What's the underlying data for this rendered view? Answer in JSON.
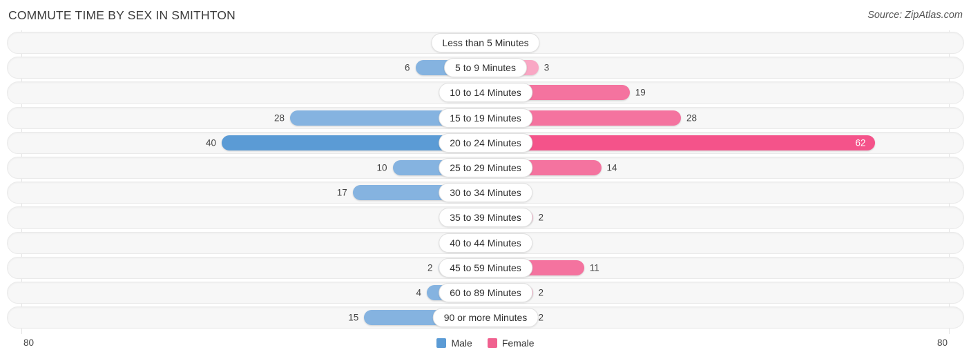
{
  "header": {
    "title": "COMMUTE TIME BY SEX IN SMITHTON",
    "source": "Source: ZipAtlas.com"
  },
  "axis": {
    "left_label": "80",
    "right_label": "80"
  },
  "legend": {
    "items": [
      {
        "label": "Male",
        "color": "#5b9bd5"
      },
      {
        "label": "Female",
        "color": "#f0618f"
      }
    ]
  },
  "colors": {
    "male_strong": "#5b9bd5",
    "male_mid": "#85b3e0",
    "male_light": "#a9c9ec",
    "female_strong": "#f4538a",
    "female_mid": "#f4739f",
    "female_light": "#f9a7c4",
    "track": "#f7f7f7",
    "gridline": "#e3e3e3"
  },
  "chart_data": {
    "type": "bar",
    "orientation": "horizontal-diverging",
    "title": "COMMUTE TIME BY SEX IN SMITHTON",
    "xlabel": "",
    "ylabel": "",
    "axis_max": 80,
    "axis_left_label": "80",
    "axis_right_label": "80",
    "grid": true,
    "legend_position": "bottom-center",
    "categories": [
      "Less than 5 Minutes",
      "5 to 9 Minutes",
      "10 to 14 Minutes",
      "15 to 19 Minutes",
      "20 to 24 Minutes",
      "25 to 29 Minutes",
      "30 to 34 Minutes",
      "35 to 39 Minutes",
      "40 to 44 Minutes",
      "45 to 59 Minutes",
      "60 to 89 Minutes",
      "90 or more Minutes"
    ],
    "series": [
      {
        "name": "Male",
        "values": [
          0,
          6,
          0,
          28,
          40,
          10,
          17,
          0,
          0,
          2,
          4,
          15
        ]
      },
      {
        "name": "Female",
        "values": [
          0,
          3,
          19,
          28,
          62,
          14,
          0,
          2,
          0,
          11,
          2,
          2
        ]
      }
    ]
  },
  "rows": [
    {
      "label": "Less than 5 Minutes",
      "male": "0",
      "female": "0",
      "male_val": 0,
      "female_val": 0
    },
    {
      "label": "5 to 9 Minutes",
      "male": "6",
      "female": "3",
      "male_val": 6,
      "female_val": 3
    },
    {
      "label": "10 to 14 Minutes",
      "male": "0",
      "female": "19",
      "male_val": 0,
      "female_val": 19
    },
    {
      "label": "15 to 19 Minutes",
      "male": "28",
      "female": "28",
      "male_val": 28,
      "female_val": 28
    },
    {
      "label": "20 to 24 Minutes",
      "male": "40",
      "female": "62",
      "male_val": 40,
      "female_val": 62
    },
    {
      "label": "25 to 29 Minutes",
      "male": "10",
      "female": "14",
      "male_val": 10,
      "female_val": 14
    },
    {
      "label": "30 to 34 Minutes",
      "male": "17",
      "female": "0",
      "male_val": 17,
      "female_val": 0
    },
    {
      "label": "35 to 39 Minutes",
      "male": "0",
      "female": "2",
      "male_val": 0,
      "female_val": 2
    },
    {
      "label": "40 to 44 Minutes",
      "male": "0",
      "female": "0",
      "male_val": 0,
      "female_val": 0
    },
    {
      "label": "45 to 59 Minutes",
      "male": "2",
      "female": "11",
      "male_val": 2,
      "female_val": 11
    },
    {
      "label": "60 to 89 Minutes",
      "male": "4",
      "female": "2",
      "male_val": 4,
      "female_val": 2
    },
    {
      "label": "90 or more Minutes",
      "male": "15",
      "female": "2",
      "male_val": 15,
      "female_val": 2
    }
  ]
}
